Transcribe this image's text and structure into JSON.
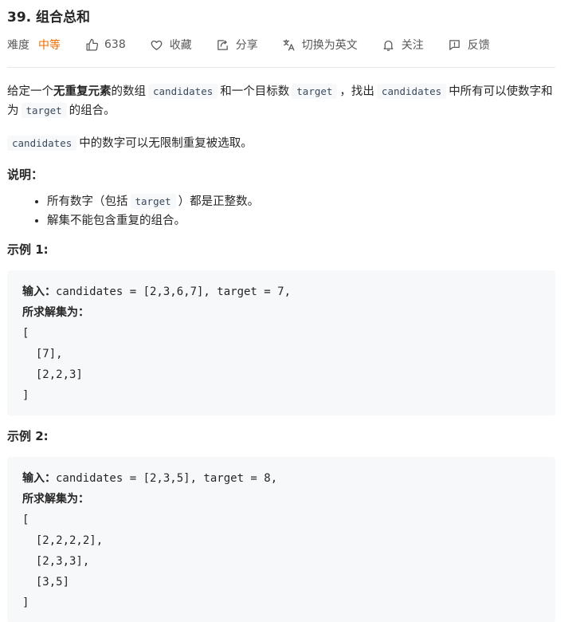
{
  "problem": {
    "title": "39. 组合总和"
  },
  "meta": {
    "difficulty_label": "难度",
    "difficulty_value": "中等",
    "likes": "638",
    "favorite": "收藏",
    "share": "分享",
    "translate": "切换为英文",
    "follow": "关注",
    "feedback": "反馈",
    "colors": {
      "difficulty": "#ef6c00",
      "code_bg": "#f7f8fa"
    },
    "icons": [
      "thumbs-up-icon",
      "heart-icon",
      "share-icon",
      "translate-icon",
      "bell-icon",
      "feedback-icon"
    ]
  },
  "description": {
    "para1": {
      "t1": "给定一个",
      "bold": "无重复元素",
      "t2": "的数组",
      "code1": "candidates",
      "t3": "和一个目标数",
      "code2": "target",
      "t4": "，找出",
      "code3": "candidates",
      "t5": "中所有可以使数字和为",
      "code4": "target",
      "t6": "的组合。"
    },
    "para2": {
      "code": "candidates",
      "text": "中的数字可以无限制重复被选取。"
    },
    "note_heading": "说明：",
    "notes": [
      {
        "t1": "所有数字（包括",
        "code": "target",
        "t2": "）都是正整数。"
      },
      {
        "t1": "解集不能包含重复的组合。"
      }
    ]
  },
  "examples": [
    {
      "heading": "示例 1:",
      "input_label": "输入：",
      "input_value": "candidates = [2,3,6,7], target = 7,",
      "output_label": "所求解集为：",
      "lines": [
        "[",
        "  [7],",
        "  [2,2,3]",
        "]"
      ]
    },
    {
      "heading": "示例 2:",
      "input_label": "输入：",
      "input_value": "candidates = [2,3,5], target = 8,",
      "output_label": "所求解集为：",
      "lines": [
        "[",
        "  [2,2,2,2],",
        "  [2,3,3],",
        "  [3,5]",
        "]"
      ]
    }
  ]
}
